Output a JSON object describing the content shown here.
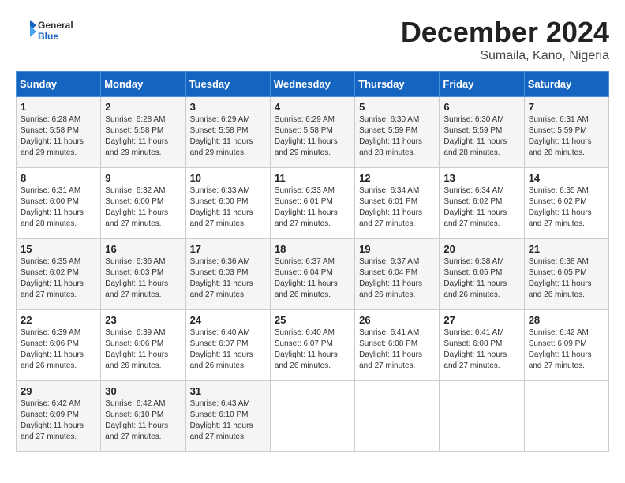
{
  "header": {
    "logo_general": "General",
    "logo_blue": "Blue",
    "month": "December 2024",
    "location": "Sumaila, Kano, Nigeria"
  },
  "days_of_week": [
    "Sunday",
    "Monday",
    "Tuesday",
    "Wednesday",
    "Thursday",
    "Friday",
    "Saturday"
  ],
  "weeks": [
    [
      {
        "day": "1",
        "sunrise": "6:28 AM",
        "sunset": "5:58 PM",
        "daylight": "11 hours and 29 minutes."
      },
      {
        "day": "2",
        "sunrise": "6:28 AM",
        "sunset": "5:58 PM",
        "daylight": "11 hours and 29 minutes."
      },
      {
        "day": "3",
        "sunrise": "6:29 AM",
        "sunset": "5:58 PM",
        "daylight": "11 hours and 29 minutes."
      },
      {
        "day": "4",
        "sunrise": "6:29 AM",
        "sunset": "5:58 PM",
        "daylight": "11 hours and 29 minutes."
      },
      {
        "day": "5",
        "sunrise": "6:30 AM",
        "sunset": "5:59 PM",
        "daylight": "11 hours and 28 minutes."
      },
      {
        "day": "6",
        "sunrise": "6:30 AM",
        "sunset": "5:59 PM",
        "daylight": "11 hours and 28 minutes."
      },
      {
        "day": "7",
        "sunrise": "6:31 AM",
        "sunset": "5:59 PM",
        "daylight": "11 hours and 28 minutes."
      }
    ],
    [
      {
        "day": "8",
        "sunrise": "6:31 AM",
        "sunset": "6:00 PM",
        "daylight": "11 hours and 28 minutes."
      },
      {
        "day": "9",
        "sunrise": "6:32 AM",
        "sunset": "6:00 PM",
        "daylight": "11 hours and 27 minutes."
      },
      {
        "day": "10",
        "sunrise": "6:33 AM",
        "sunset": "6:00 PM",
        "daylight": "11 hours and 27 minutes."
      },
      {
        "day": "11",
        "sunrise": "6:33 AM",
        "sunset": "6:01 PM",
        "daylight": "11 hours and 27 minutes."
      },
      {
        "day": "12",
        "sunrise": "6:34 AM",
        "sunset": "6:01 PM",
        "daylight": "11 hours and 27 minutes."
      },
      {
        "day": "13",
        "sunrise": "6:34 AM",
        "sunset": "6:02 PM",
        "daylight": "11 hours and 27 minutes."
      },
      {
        "day": "14",
        "sunrise": "6:35 AM",
        "sunset": "6:02 PM",
        "daylight": "11 hours and 27 minutes."
      }
    ],
    [
      {
        "day": "15",
        "sunrise": "6:35 AM",
        "sunset": "6:02 PM",
        "daylight": "11 hours and 27 minutes."
      },
      {
        "day": "16",
        "sunrise": "6:36 AM",
        "sunset": "6:03 PM",
        "daylight": "11 hours and 27 minutes."
      },
      {
        "day": "17",
        "sunrise": "6:36 AM",
        "sunset": "6:03 PM",
        "daylight": "11 hours and 27 minutes."
      },
      {
        "day": "18",
        "sunrise": "6:37 AM",
        "sunset": "6:04 PM",
        "daylight": "11 hours and 26 minutes."
      },
      {
        "day": "19",
        "sunrise": "6:37 AM",
        "sunset": "6:04 PM",
        "daylight": "11 hours and 26 minutes."
      },
      {
        "day": "20",
        "sunrise": "6:38 AM",
        "sunset": "6:05 PM",
        "daylight": "11 hours and 26 minutes."
      },
      {
        "day": "21",
        "sunrise": "6:38 AM",
        "sunset": "6:05 PM",
        "daylight": "11 hours and 26 minutes."
      }
    ],
    [
      {
        "day": "22",
        "sunrise": "6:39 AM",
        "sunset": "6:06 PM",
        "daylight": "11 hours and 26 minutes."
      },
      {
        "day": "23",
        "sunrise": "6:39 AM",
        "sunset": "6:06 PM",
        "daylight": "11 hours and 26 minutes."
      },
      {
        "day": "24",
        "sunrise": "6:40 AM",
        "sunset": "6:07 PM",
        "daylight": "11 hours and 26 minutes."
      },
      {
        "day": "25",
        "sunrise": "6:40 AM",
        "sunset": "6:07 PM",
        "daylight": "11 hours and 26 minutes."
      },
      {
        "day": "26",
        "sunrise": "6:41 AM",
        "sunset": "6:08 PM",
        "daylight": "11 hours and 27 minutes."
      },
      {
        "day": "27",
        "sunrise": "6:41 AM",
        "sunset": "6:08 PM",
        "daylight": "11 hours and 27 minutes."
      },
      {
        "day": "28",
        "sunrise": "6:42 AM",
        "sunset": "6:09 PM",
        "daylight": "11 hours and 27 minutes."
      }
    ],
    [
      {
        "day": "29",
        "sunrise": "6:42 AM",
        "sunset": "6:09 PM",
        "daylight": "11 hours and 27 minutes."
      },
      {
        "day": "30",
        "sunrise": "6:42 AM",
        "sunset": "6:10 PM",
        "daylight": "11 hours and 27 minutes."
      },
      {
        "day": "31",
        "sunrise": "6:43 AM",
        "sunset": "6:10 PM",
        "daylight": "11 hours and 27 minutes."
      },
      null,
      null,
      null,
      null
    ]
  ]
}
